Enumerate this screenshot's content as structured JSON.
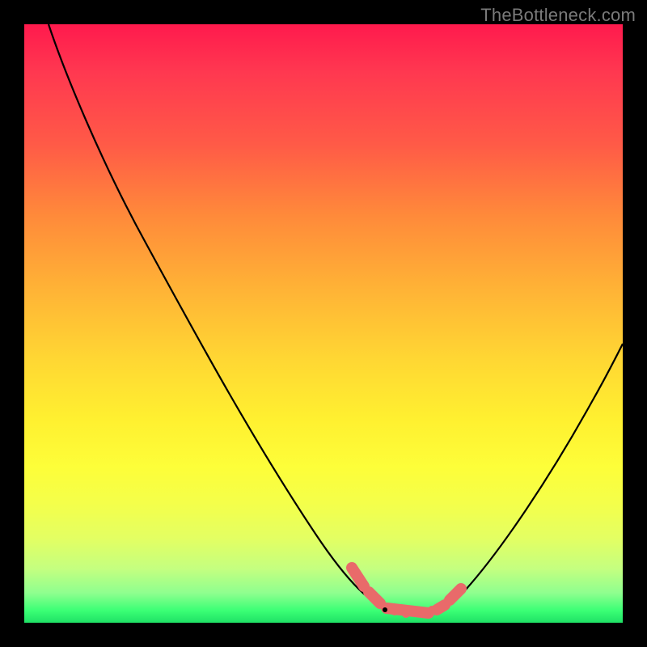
{
  "watermark": "TheBottleneck.com",
  "chart_data": {
    "type": "line",
    "title": "",
    "xlabel": "",
    "ylabel": "",
    "xlim": [
      0,
      100
    ],
    "ylim": [
      0,
      100
    ],
    "grid": false,
    "series": [
      {
        "name": "bottleneck-curve",
        "x": [
          4,
          10,
          20,
          30,
          40,
          50,
          56,
          60,
          64,
          68,
          72,
          80,
          90,
          100
        ],
        "y": [
          100,
          86,
          69,
          53,
          37,
          20,
          8,
          3,
          1,
          1,
          3,
          12,
          30,
          52
        ],
        "color": "#000000"
      }
    ],
    "highlight_band": {
      "name": "optimal-range",
      "color": "#e96a6a",
      "points_x": [
        55,
        58,
        61,
        63,
        65,
        67,
        69,
        71
      ],
      "points_y": [
        8,
        4,
        2,
        1,
        1,
        1,
        2,
        4
      ]
    },
    "background_gradient": {
      "stops": [
        "#ff1a4d",
        "#ffd733",
        "#fdfe39",
        "#1fe065"
      ],
      "direction": "top-to-bottom"
    }
  }
}
